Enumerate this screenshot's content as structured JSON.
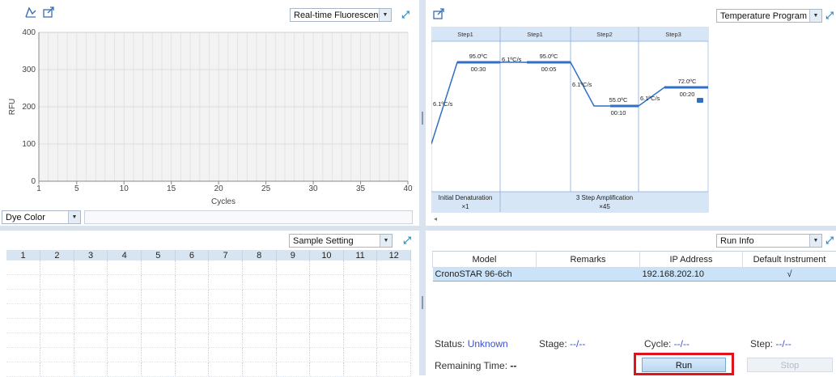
{
  "fluorescence_panel": {
    "view_select": "Real-time Fluorescence",
    "y_axis_label": "RFU",
    "x_axis_label": "Cycles",
    "y_ticks": [
      "400",
      "300",
      "200",
      "100",
      "0"
    ],
    "x_ticks": [
      "1",
      "5",
      "10",
      "15",
      "20",
      "25",
      "30",
      "35",
      "40"
    ],
    "dye_color_select": "Dye Color"
  },
  "temperature_panel": {
    "view_select": "Temperature Program",
    "step_headers": [
      "Step1",
      "Step1",
      "Step2",
      "Step3"
    ],
    "step_temps": [
      "95.0ºC",
      "95.0ºC",
      "55.0ºC",
      "72.0ºC"
    ],
    "step_times": [
      "00:30",
      "00:05",
      "00:10",
      "00:20"
    ],
    "ramp_rates": [
      "6.1ºC/s",
      "6.1ºC/s",
      "6.1ºC/s",
      "6.1ºC/s"
    ],
    "stage1_name": "Initial Denaturation",
    "stage1_cycles": "×1",
    "stage2_name": "3 Step Amplification",
    "stage2_cycles": "×45"
  },
  "sample_panel": {
    "view_select": "Sample Setting",
    "columns": [
      "1",
      "2",
      "3",
      "4",
      "5",
      "6",
      "7",
      "8",
      "9",
      "10",
      "11",
      "12"
    ]
  },
  "run_panel": {
    "view_select": "Run Info",
    "headers": [
      "Model",
      "Remarks",
      "IP Address",
      "Default Instrument"
    ],
    "row": {
      "model": "CronoSTAR 96-6ch",
      "remarks": "",
      "ip": "192.168.202.10",
      "default": "√"
    },
    "status_label": "Status:",
    "status_value": "Unknown",
    "stage_label": "Stage:",
    "stage_value": "--/--",
    "cycle_label": "Cycle:",
    "cycle_value": "--/--",
    "step_label": "Step:",
    "step_value": "--/--",
    "remaining_label": "Remaining Time:",
    "remaining_value": "--",
    "run_button": "Run",
    "stop_button": "Stop"
  },
  "colors": {
    "accent": "#1a8fd2",
    "highlight": "#e0121b",
    "program_line": "#2f6fc4"
  }
}
